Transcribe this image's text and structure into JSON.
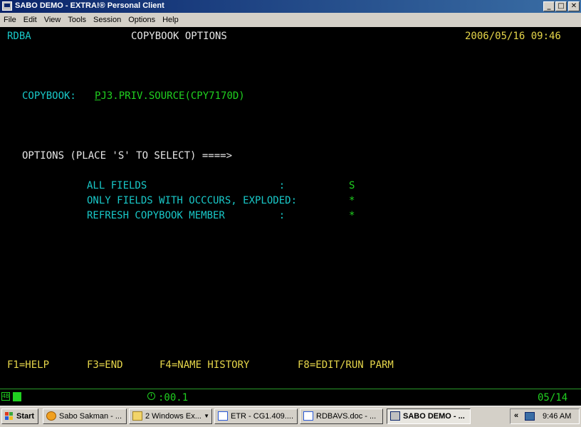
{
  "window": {
    "title": "SABO DEMO - EXTRA!® Personal Client",
    "buttons": {
      "minimize": "_",
      "maximize": "□",
      "close": "✕"
    }
  },
  "menu": [
    "File",
    "Edit",
    "View",
    "Tools",
    "Session",
    "Options",
    "Help"
  ],
  "screen": {
    "system": "RDBA",
    "title": "COPYBOOK OPTIONS",
    "datetime": "2006/05/16 09:46",
    "copybook_label": "COPYBOOK:",
    "copybook_cursor_char": "P",
    "copybook_value_rest": "J3.PRIV.SOURCE(CPY7170D)",
    "options_prompt": "OPTIONS (PLACE 'S' TO SELECT) ====>",
    "options": [
      {
        "label": "ALL FIELDS                      :",
        "value": "S"
      },
      {
        "label": "ONLY FIELDS WITH OCCCURS, EXPLODED:",
        "value": "*"
      },
      {
        "label": "REFRESH COPYBOOK MEMBER         :",
        "value": "*"
      }
    ],
    "function_keys": [
      "F1=HELP",
      "F3=END",
      "F4=NAME HISTORY",
      "F8=EDIT/RUN PARM"
    ]
  },
  "status": {
    "session_indicator": "4B",
    "elapsed": ":00.1",
    "cursor_pos": "05/14"
  },
  "taskbar": {
    "start": "Start",
    "tasks": [
      {
        "label": "Sabo Sakman - ...",
        "icon": "browser-icon"
      },
      {
        "label": "2 Windows Ex...",
        "icon": "folder-icon"
      },
      {
        "label": "ETR - CG1.409....",
        "icon": "document-icon"
      },
      {
        "label": "RDBAVS.doc - ...",
        "icon": "document-icon"
      },
      {
        "label": "SABO DEMO - ...",
        "icon": "terminal-icon"
      }
    ],
    "tray_chevron": "«",
    "clock": "9:46 AM"
  }
}
